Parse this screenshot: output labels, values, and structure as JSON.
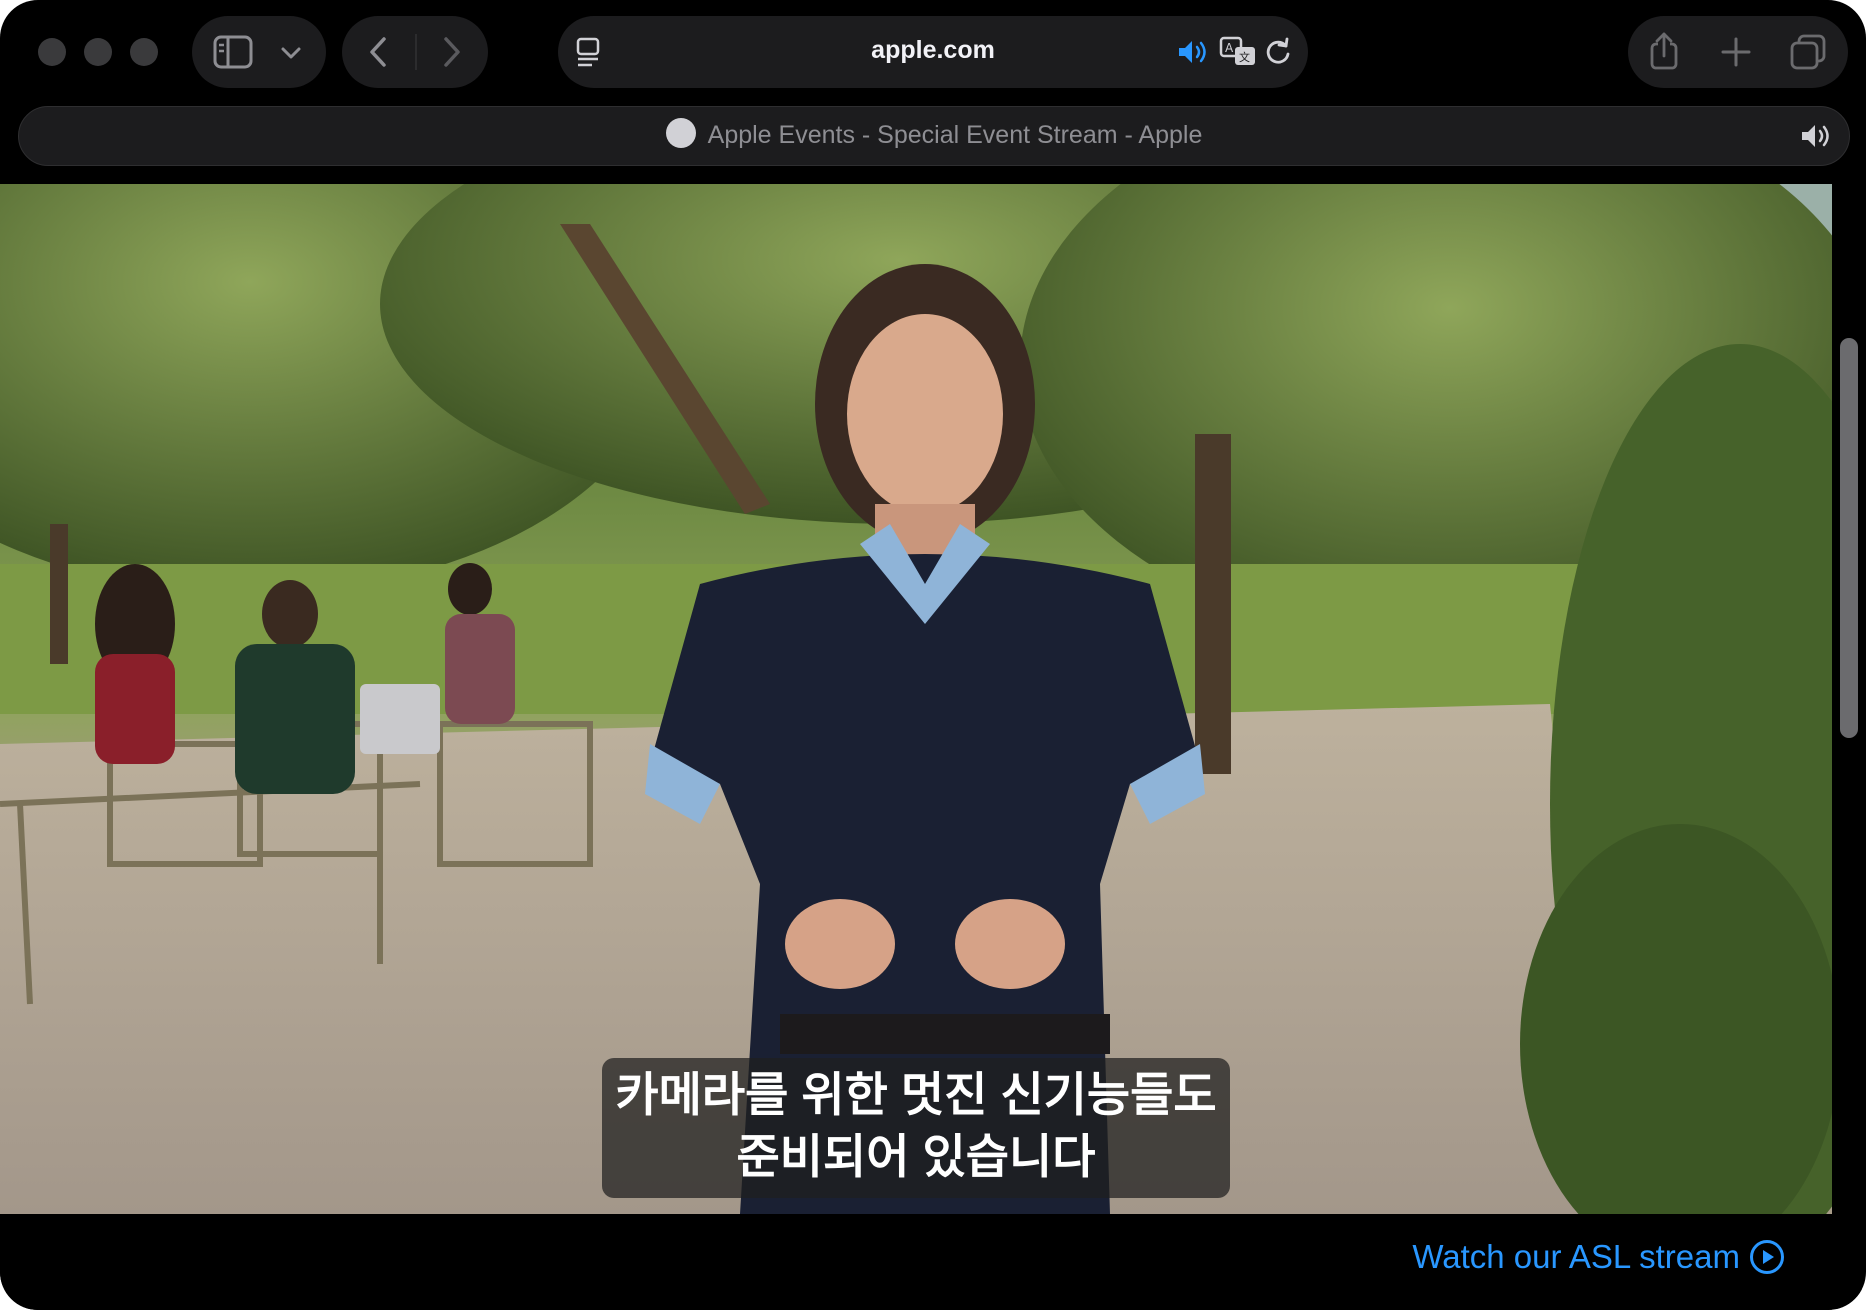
{
  "browser": {
    "url": "apple.com",
    "tab_title": "Apple Events - Special Event Stream - Apple",
    "accent_color": "#2997ff",
    "icons": {
      "sidebar": "sidebar-icon",
      "chevron": "chevron-down-icon",
      "back": "back-icon",
      "forward": "forward-icon",
      "reader": "reader-icon",
      "audio": "speaker-icon",
      "translate": "translate-icon",
      "reload": "reload-icon",
      "share": "share-icon",
      "new_tab": "plus-icon",
      "tabs": "tab-overview-icon"
    }
  },
  "video": {
    "subtitle_lines": [
      "카메라를 위한 멋진 신기능들도",
      "준비되어 있습니다"
    ]
  },
  "page": {
    "asl_link": "Watch our ASL stream"
  }
}
